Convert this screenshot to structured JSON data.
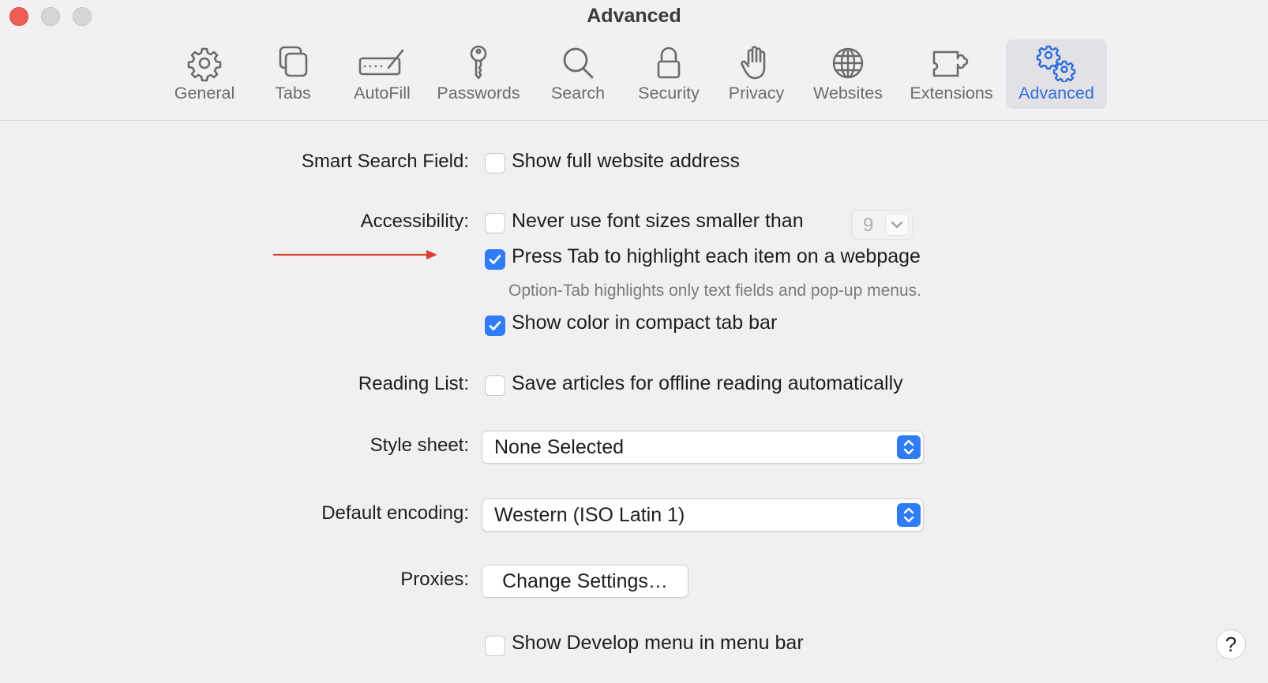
{
  "window": {
    "title": "Advanced"
  },
  "toolbar": {
    "items": [
      {
        "label": "General",
        "icon": "gear-icon"
      },
      {
        "label": "Tabs",
        "icon": "tabs-icon"
      },
      {
        "label": "AutoFill",
        "icon": "autofill-pencil-icon"
      },
      {
        "label": "Passwords",
        "icon": "key-icon"
      },
      {
        "label": "Search",
        "icon": "magnifier-icon"
      },
      {
        "label": "Security",
        "icon": "lock-icon"
      },
      {
        "label": "Privacy",
        "icon": "hand-icon"
      },
      {
        "label": "Websites",
        "icon": "globe-icon"
      },
      {
        "label": "Extensions",
        "icon": "puzzle-icon"
      },
      {
        "label": "Advanced",
        "icon": "gears-icon",
        "selected": true
      }
    ]
  },
  "settings": {
    "smart_search": {
      "label": "Smart Search Field:",
      "option": "Show full website address",
      "checked": false
    },
    "accessibility": {
      "label": "Accessibility:",
      "font_size_option": "Never use font sizes smaller than",
      "font_size_checked": false,
      "font_size_value": "9",
      "tab_option": "Press Tab to highlight each item on a webpage",
      "tab_checked": true,
      "tab_note": "Option-Tab highlights only text fields and pop-up menus.",
      "color_option": "Show color in compact tab bar",
      "color_checked": true
    },
    "reading_list": {
      "label": "Reading List:",
      "option": "Save articles for offline reading automatically",
      "checked": false
    },
    "style_sheet": {
      "label": "Style sheet:",
      "value": "None Selected"
    },
    "encoding": {
      "label": "Default encoding:",
      "value": "Western (ISO Latin 1)"
    },
    "proxies": {
      "label": "Proxies:",
      "button": "Change Settings…"
    },
    "develop": {
      "option": "Show Develop menu in menu bar",
      "checked": false
    }
  },
  "help": {
    "label": "?"
  },
  "colors": {
    "accent": "#2f7cf6",
    "annotation_arrow": "#d8412f",
    "close_button": "#ee5e57"
  }
}
